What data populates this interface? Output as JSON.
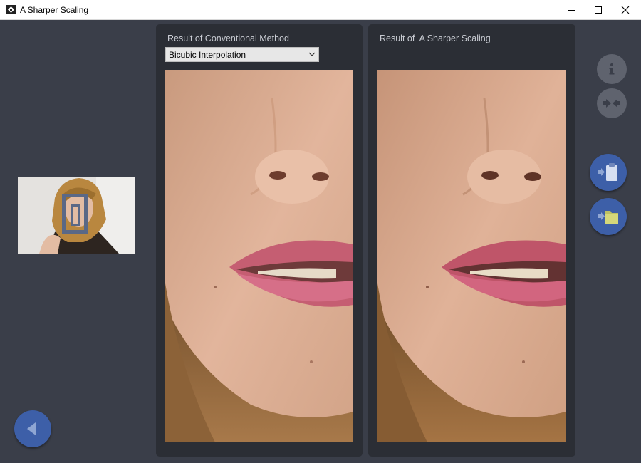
{
  "window": {
    "title": "A Sharper Scaling",
    "controls": [
      "minimize",
      "maximize",
      "close"
    ]
  },
  "left_panel": {
    "thumbnail_icon": "source-image-thumbnail",
    "back_button_icon": "back-arrow-icon"
  },
  "conventional_panel": {
    "title": "Result of Conventional Method",
    "method_select": {
      "selected": "Bicubic Interpolation"
    }
  },
  "sharper_panel": {
    "title": "Result of  A Sharper Scaling"
  },
  "side_toolbar": {
    "buttons": [
      "info-icon",
      "compare-icon",
      "paste-clipboard-icon",
      "open-folder-icon"
    ]
  },
  "colors": {
    "background": "#3a3e49",
    "panel": "#2b2e35",
    "accent_button": "#3d5fa8",
    "disabled_button": "#5f636e",
    "panel_text": "#c9ccd3"
  }
}
